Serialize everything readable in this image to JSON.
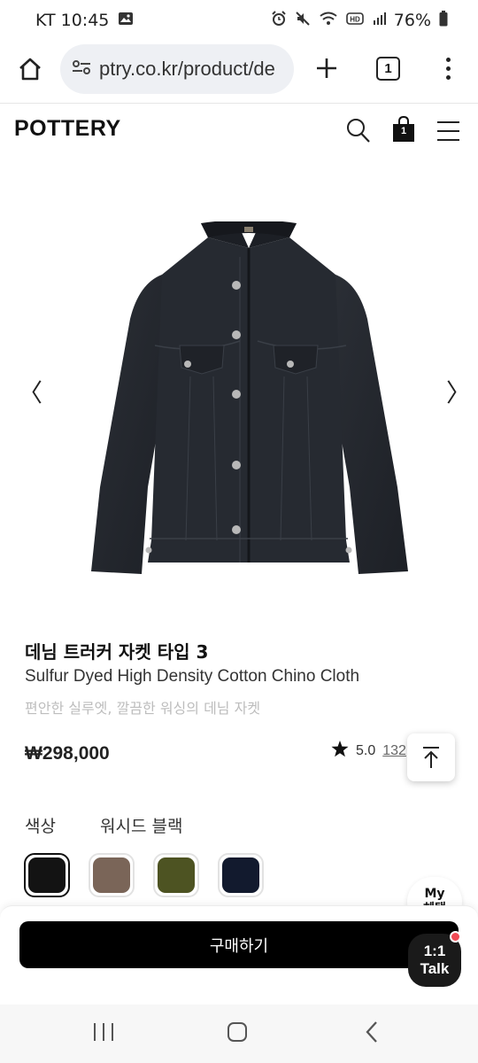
{
  "status_bar": {
    "carrier_time": "KT 10:45",
    "battery": "76%",
    "icons": [
      "image-icon",
      "alarm-icon",
      "mute-icon",
      "wifi-icon",
      "hd-icon",
      "signal-icon",
      "battery-icon"
    ]
  },
  "browser": {
    "url": "ptry.co.kr/product/de",
    "tab_count": "1"
  },
  "site": {
    "logo": "POTTERY",
    "cart_count": "1"
  },
  "gallery": {
    "prev_arrow": "〈",
    "next_arrow": "〉"
  },
  "product": {
    "name": "데님 트러커 자켓 타입 3",
    "name_en": "Sulfur Dyed High Density Cotton Chino Cloth",
    "description": "편안한 실루엣, 깔끔한 워싱의 데님 자켓",
    "price": "₩298,000",
    "rating": "5.0",
    "review_count": "132"
  },
  "options": {
    "color_label": "색상",
    "color_value": "워시드 블랙",
    "swatches": [
      {
        "color": "#131313",
        "selected": true
      },
      {
        "color": "#7a6558",
        "selected": false
      },
      {
        "color": "#4d5322",
        "selected": false
      },
      {
        "color": "#121a2e",
        "selected": false
      }
    ]
  },
  "actions": {
    "buy_label": "구매하기",
    "benefit_line1": "My",
    "benefit_line2": "혜택",
    "talk_line1": "1:1",
    "talk_line2": "Talk"
  },
  "colors": {
    "accent": "#000000",
    "notification_dot": "#f04a55",
    "description_text": "#bdbdbd"
  }
}
